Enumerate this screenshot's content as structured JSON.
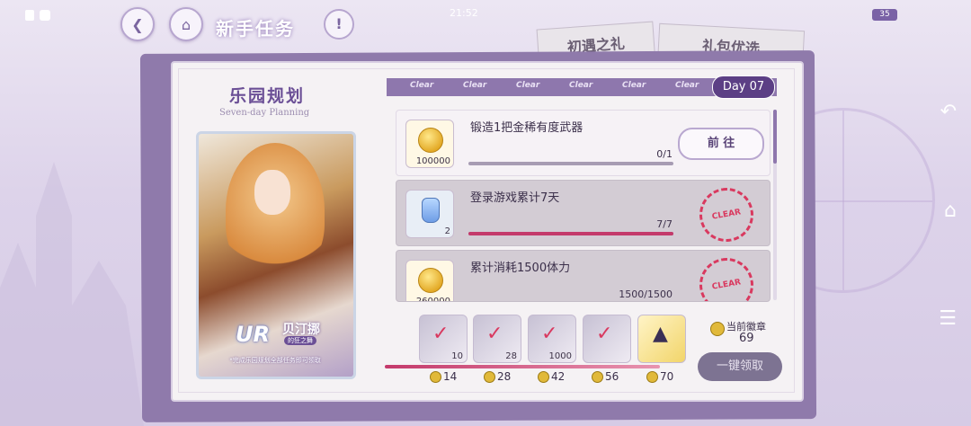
{
  "status_bar": {
    "time": "21:52",
    "battery": "35"
  },
  "header": {
    "title": "新手任务",
    "help": "!"
  },
  "tabs": [
    "初遇之礼",
    "礼包优选"
  ],
  "panel": {
    "title": "乐园规划",
    "subtitle": "Seven-day Planning",
    "day": "Day 07",
    "clear_tags": [
      "Clear",
      "Clear",
      "Clear",
      "Clear",
      "Clear",
      "Clear"
    ]
  },
  "character": {
    "rarity": "UR",
    "name": "贝汀挪",
    "tag": "的狂之舞",
    "note": "*完成乐园规划全部任务即可领取"
  },
  "tasks": [
    {
      "reward": "100000",
      "title": "锻造1把金稀有度武器",
      "progress": "0/1",
      "fraction": 0,
      "action": "前 往",
      "state": "active"
    },
    {
      "reward": "2",
      "title": "登录游戏累计7天",
      "progress": "7/7",
      "fraction": 1,
      "stamp": "CLEAR",
      "state": "done"
    },
    {
      "reward": "260000",
      "title": "累计消耗1500体力",
      "progress": "1500/1500",
      "fraction": 1,
      "stamp": "CLEAR",
      "state": "done"
    }
  ],
  "rewards": [
    {
      "count": "10",
      "tier": "14"
    },
    {
      "count": "28",
      "tier": "28"
    },
    {
      "count": "1000",
      "tier": "42"
    },
    {
      "count": "",
      "tier": "56"
    },
    {
      "count": "",
      "tier": "70"
    }
  ],
  "badge": {
    "label": "当前徽章",
    "value": "69"
  },
  "claim_all": "一键领取",
  "colors": {
    "accent": "#8e77ad",
    "clear_red": "#d9395f",
    "progress": "#c43a6b"
  }
}
